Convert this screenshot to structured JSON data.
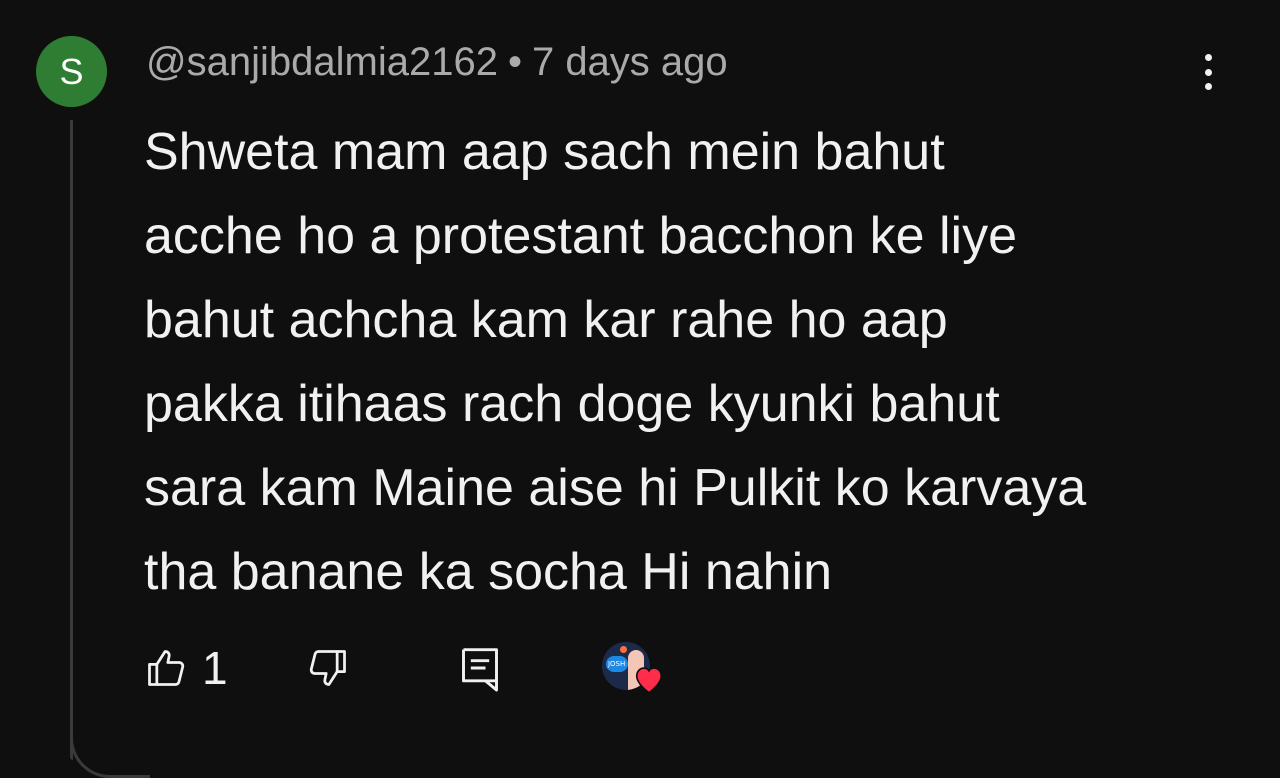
{
  "comment": {
    "avatar_letter": "S",
    "username": "@sanjibdalmia2162",
    "separator": "•",
    "timestamp": "7 days ago",
    "text_lines": [
      "Shweta mam aap sach mein bahut",
      "acche ho a protestant bacchon ke liye",
      "bahut achcha kam kar rahe ho aap",
      "pakka itihaas rach doge kyunki bahut",
      "sara kam Maine aise hi Pulkit ko karvaya",
      "tha banane ka socha Hi nahin"
    ],
    "like_count": "1",
    "creator_avatar_label": "JOSH"
  },
  "colors": {
    "background": "#0f0f0f",
    "avatar": "#2f7d32",
    "heart": "#ff2d4a",
    "muted_text": "#aaaaaa"
  },
  "icons": [
    "thumbs-up-icon",
    "thumbs-down-icon",
    "reply-icon",
    "more-vert-icon",
    "heart-icon"
  ]
}
